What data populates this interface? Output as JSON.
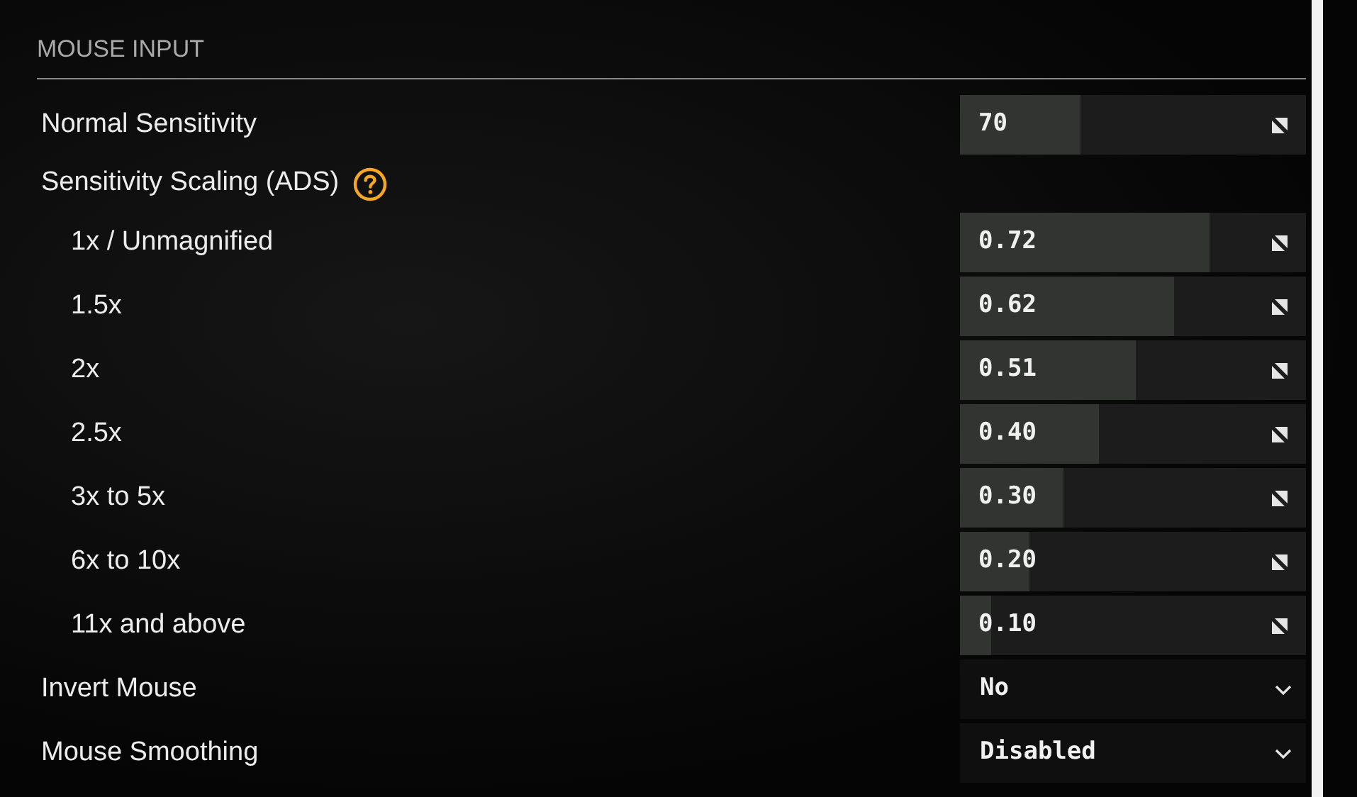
{
  "section": {
    "title": "MOUSE INPUT"
  },
  "settings": [
    {
      "kind": "slider",
      "label": "Normal Sensitivity",
      "value": "70",
      "level": 0.35
    },
    {
      "kind": "group",
      "label": "Sensitivity Scaling (ADS)",
      "children": [
        {
          "kind": "slider",
          "label": "1x / Unmagnified",
          "value": "0.72",
          "level": 0.72
        },
        {
          "kind": "slider",
          "label": "1.5x",
          "value": "0.62",
          "level": 0.62
        },
        {
          "kind": "slider",
          "label": "2x",
          "value": "0.51",
          "level": 0.51
        },
        {
          "kind": "slider",
          "label": "2.5x",
          "value": "0.40",
          "level": 0.4
        },
        {
          "kind": "slider",
          "label": "3x to 5x",
          "value": "0.30",
          "level": 0.3
        },
        {
          "kind": "slider",
          "label": "6x to 10x",
          "value": "0.20",
          "level": 0.2
        },
        {
          "kind": "slider",
          "label": "11x and above",
          "value": "0.10",
          "level": 0.09
        }
      ]
    },
    {
      "kind": "dropdown",
      "label": "Invert Mouse",
      "value": "No"
    },
    {
      "kind": "dropdown",
      "label": "Mouse Smoothing",
      "value": "Disabled"
    }
  ]
}
